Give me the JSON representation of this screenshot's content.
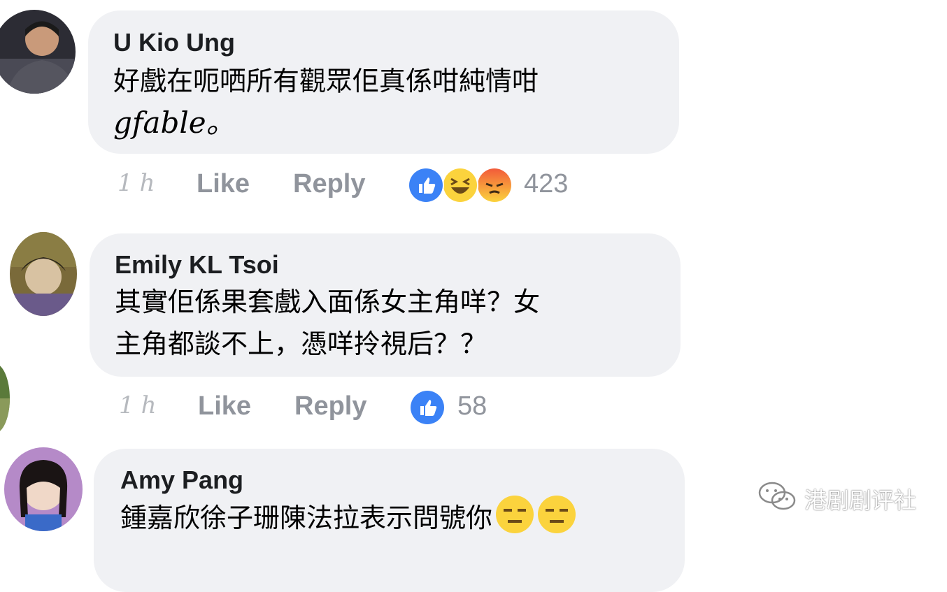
{
  "comments": [
    {
      "author": "U Kio Ung",
      "text_line1": "好戲在呃哂所有觀眾佢真係咁純情咁",
      "text_line2": "gfable。",
      "time": "1h",
      "like_label": "Like",
      "reply_label": "Reply",
      "reactions": [
        "like-icon",
        "haha-icon",
        "angry-icon"
      ],
      "reaction_count": "423"
    },
    {
      "author": "Emily KL Tsoi",
      "text_line1": "其實佢係果套戲入面係女主角咩？女",
      "text_line2": "主角都談不上，憑咩拎視后？？",
      "time": "1h",
      "like_label": "Like",
      "reply_label": "Reply",
      "reactions": [
        "like-icon"
      ],
      "reaction_count": "58"
    },
    {
      "author": "Amy Pang",
      "text_line1": "鍾嘉欣徐子珊陳法拉表示問號你",
      "inline_emojis": [
        "expressionless-face-icon",
        "expressionless-face-icon"
      ]
    }
  ],
  "watermark": {
    "text": "港剧剧评社",
    "icon": "wechat-icon"
  },
  "colors": {
    "bubble": "#f0f1f4",
    "meta_text": "#90949c",
    "like_blue": "#3b82f6",
    "emoji_yellow": "#fbd33d",
    "angry_orange": "#f47e3a"
  }
}
